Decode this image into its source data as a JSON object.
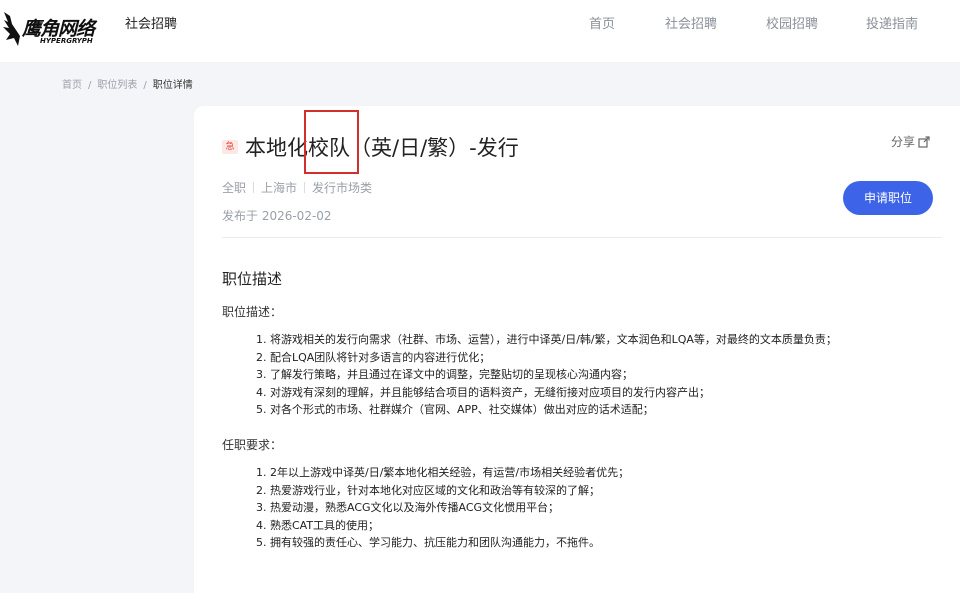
{
  "brand": {
    "logo_cn": "鹰角网络",
    "logo_en": "HYPERGRYPH",
    "sub_title": "社会招聘"
  },
  "nav": [
    "首页",
    "社会招聘",
    "校园招聘",
    "投递指南"
  ],
  "breadcrumb": [
    "首页",
    "职位列表",
    "职位详情"
  ],
  "job": {
    "urgent_tag": "急",
    "title": "本地化校队（英/日/繁）-发行",
    "share_label": "分享",
    "meta": [
      "全职",
      "上海市",
      "发行市场类"
    ],
    "posted": "发布于 2026-02-02",
    "apply_label": "申请职位"
  },
  "description": {
    "section_title": "职位描述",
    "duties_label": "职位描述：",
    "duties": [
      "1. 将游戏相关的发行向需求（社群、市场、运营），进行中译英/日/韩/繁，文本润色和LQA等，对最终的文本质量负责；",
      "2. 配合LQA团队将针对多语言的内容进行优化；",
      "3. 了解发行策略，并且通过在译文中的调整，完整贴切的呈现核心沟通内容；",
      "4. 对游戏有深刻的理解，并且能够结合项目的语料资产，无缝衔接对应项目的发行内容产出；",
      "5. 对各个形式的市场、社群媒介（官网、APP、社交媒体）做出对应的话术适配；"
    ],
    "requirements_label": "任职要求：",
    "requirements": [
      "1. 2年以上游戏中译英/日/繁本地化相关经验，有运营/市场相关经验者优先；",
      "2. 热爱游戏行业，针对本地化对应区域的文化和政治等有较深的了解；",
      "3. 热爱动漫，熟悉ACG文化以及海外传播ACG文化惯用平台；",
      "4. 熟悉CAT工具的使用；",
      "5. 拥有较强的责任心、学习能力、抗压能力和团队沟通能力，不拖件。"
    ]
  },
  "colors": {
    "accent": "#3d63e8",
    "urgent": "#e64a3b",
    "highlight_box": "#d32f2f"
  }
}
